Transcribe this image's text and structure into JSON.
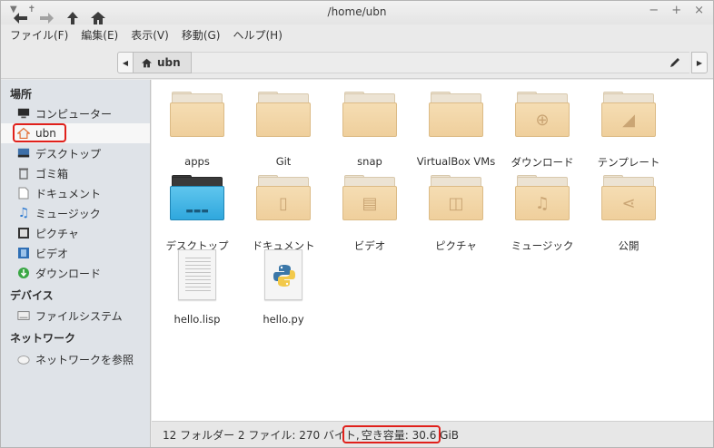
{
  "window": {
    "title": "/home/ubn"
  },
  "menu": [
    "ファイル(F)",
    "編集(E)",
    "表示(V)",
    "移動(G)",
    "ヘルプ(H)"
  ],
  "path": {
    "crumb": "ubn"
  },
  "sidebar": {
    "places_heading": "場所",
    "places": [
      {
        "label": "コンピューター",
        "icon": "computer-icon"
      },
      {
        "label": "ubn",
        "icon": "home-icon",
        "selected": true
      },
      {
        "label": "デスクトップ",
        "icon": "desktop-icon"
      },
      {
        "label": "ゴミ箱",
        "icon": "trash-icon"
      },
      {
        "label": "ドキュメント",
        "icon": "document-icon"
      },
      {
        "label": "ミュージック",
        "icon": "music-icon"
      },
      {
        "label": "ピクチャ",
        "icon": "picture-icon"
      },
      {
        "label": "ビデオ",
        "icon": "video-icon"
      },
      {
        "label": "ダウンロード",
        "icon": "download-icon"
      }
    ],
    "devices_heading": "デバイス",
    "devices": [
      {
        "label": "ファイルシステム",
        "icon": "drive-icon"
      }
    ],
    "network_heading": "ネットワーク",
    "network": [
      {
        "label": "ネットワークを参照",
        "icon": "network-icon"
      }
    ]
  },
  "files": [
    {
      "name": "apps",
      "kind": "folder"
    },
    {
      "name": "Git",
      "kind": "folder"
    },
    {
      "name": "snap",
      "kind": "folder"
    },
    {
      "name": "VirtualBox VMs",
      "kind": "folder"
    },
    {
      "name": "ダウンロード",
      "kind": "folder-download"
    },
    {
      "name": "テンプレート",
      "kind": "folder-templates"
    },
    {
      "name": "デスクトップ",
      "kind": "folder-desktop"
    },
    {
      "name": "ドキュメント",
      "kind": "folder-documents"
    },
    {
      "name": "ビデオ",
      "kind": "folder-videos"
    },
    {
      "name": "ピクチャ",
      "kind": "folder-pictures"
    },
    {
      "name": "ミュージック",
      "kind": "folder-music"
    },
    {
      "name": "公開",
      "kind": "folder-public"
    },
    {
      "name": "hello.lisp",
      "kind": "text-file"
    },
    {
      "name": "hello.py",
      "kind": "python-file"
    }
  ],
  "status": {
    "summary": "12 フォルダー 2 ファイル: 270 バイト, ",
    "free_space": "空き容量: 30.6 GiB"
  },
  "colors": {
    "highlight": "#e0201b",
    "folder": "#f2d5a6",
    "sidebar": "#dfe3e8"
  }
}
